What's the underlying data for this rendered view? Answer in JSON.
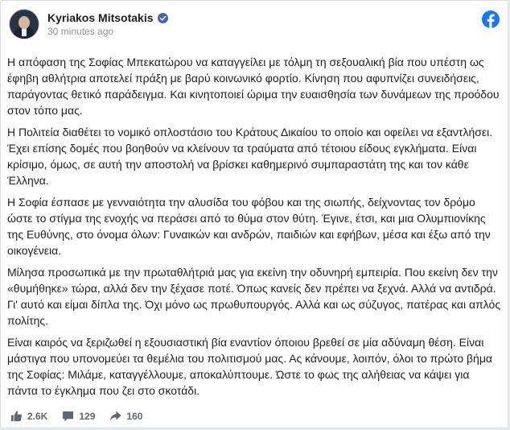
{
  "post": {
    "author": "Kyriakos Mitsotakis",
    "timestamp": "30 minutes ago",
    "paragraphs": [
      "Η απόφαση της Σοφίας Μπεκατώρου να καταγγείλει με τόλμη τη σεξουαλική βία που υπέστη ως έφηβη αθλήτρια αποτελεί πράξη με βαρύ κοινωνικό φορτίο. Κίνηση που αφυπνίζει συνειδήσεις, παράγοντας θετικό παράδειγμα. Και κινητοποιεί ώριμα την ευαισθησία των δυνάμεων της προόδου στον τόπο μας.",
      "Η Πολιτεία διαθέτει το νομικό οπλοστάσιο του Κράτους Δικαίου το οποίο και οφείλει να εξαντλήσει. Έχει επίσης δομές που βοηθούν να κλείνουν τα τραύματα από τέτοιου είδους εγκλήματα. Είναι κρίσιμο, όμως, σε αυτή την αποστολή να βρίσκει καθημερινό συμπαραστάτη της και τον κάθε Έλληνα.",
      "Η Σοφία έσπασε με γενναιότητα την αλυσίδα του φόβου και της σιωπής, δείχνοντας τον δρόμο ώστε το στίγμα της ενοχής να περάσει από το θύμα στον θύτη. Έγινε, έτσι, και μια Ολυμπιονίκης της Ευθύνης, στο όνομα όλων: Γυναικών και ανδρών, παιδιών και εφήβων, μέσα και έξω από την οικογένεια.",
      "Μίλησα προσωπικά με την πρωταθλήτριά μας για εκείνη την οδυνηρή εμπειρία. Που εκείνη δεν την «θυμήθηκε» τώρα, αλλά δεν την ξέχασε ποτέ. Όπως κανείς δεν πρέπει να ξεχνά. Αλλά να αντιδρά. Γι' αυτό και είμαι δίπλα της. Όχι μόνο ως πρωθυπουργός. Αλλά και ως σύζυγος, πατέρας και απλός πολίτης.",
      "Είναι καιρός να ξεριζωθεί η εξουσιαστική βία εναντίον όποιου βρεθεί σε μία αδύναμη θέση. Είναι μάστιγα που υπονομεύει τα θεμέλια του πολιτισμού μας. Ας κάνουμε, λοιπόν, όλοι το πρώτο βήμα της Σοφίας: Μιλάμε, καταγγέλλουμε, αποκαλύπτουμε. Ώστε το φως της αλήθειας να κάψει για πάντα το έγκλημα που ζει στο σκοτάδι."
    ]
  },
  "stats": {
    "likes": "2.6K",
    "comments": "129",
    "shares": "160"
  },
  "icons": {
    "verified": "verified-badge-icon",
    "brand": "facebook-logo-icon",
    "like": "thumbs-up-icon",
    "comment": "comment-icon",
    "share": "share-arrow-icon"
  },
  "colors": {
    "facebook_blue": "#1877f2",
    "verified_blue": "#4267b2",
    "secondary_text": "#90949c"
  }
}
